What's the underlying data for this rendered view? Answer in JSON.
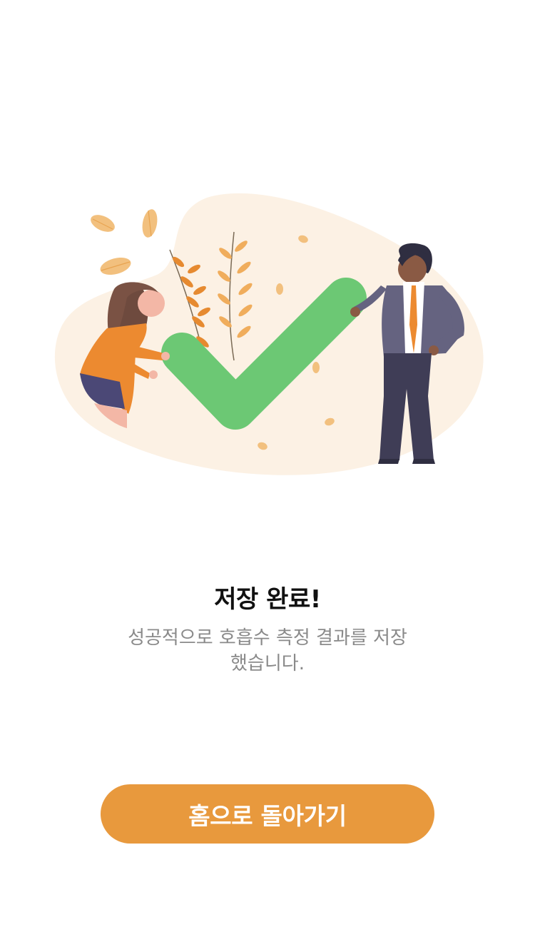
{
  "result": {
    "title": "저장 완료!",
    "message": "성공적으로 호흡수 측정 결과를 저장 했습니다."
  },
  "actions": {
    "home_label": "홈으로 돌아가기"
  },
  "illustration": {
    "icon": "check-mark-icon",
    "colors": {
      "blob": "#fcf1e4",
      "check": "#6cc874",
      "accent": "#e8993d",
      "leaf": "#f2b86a"
    }
  },
  "colors": {
    "button": "#e8993d",
    "title": "#111111",
    "message": "#8a8a8a",
    "background": "#ffffff"
  }
}
